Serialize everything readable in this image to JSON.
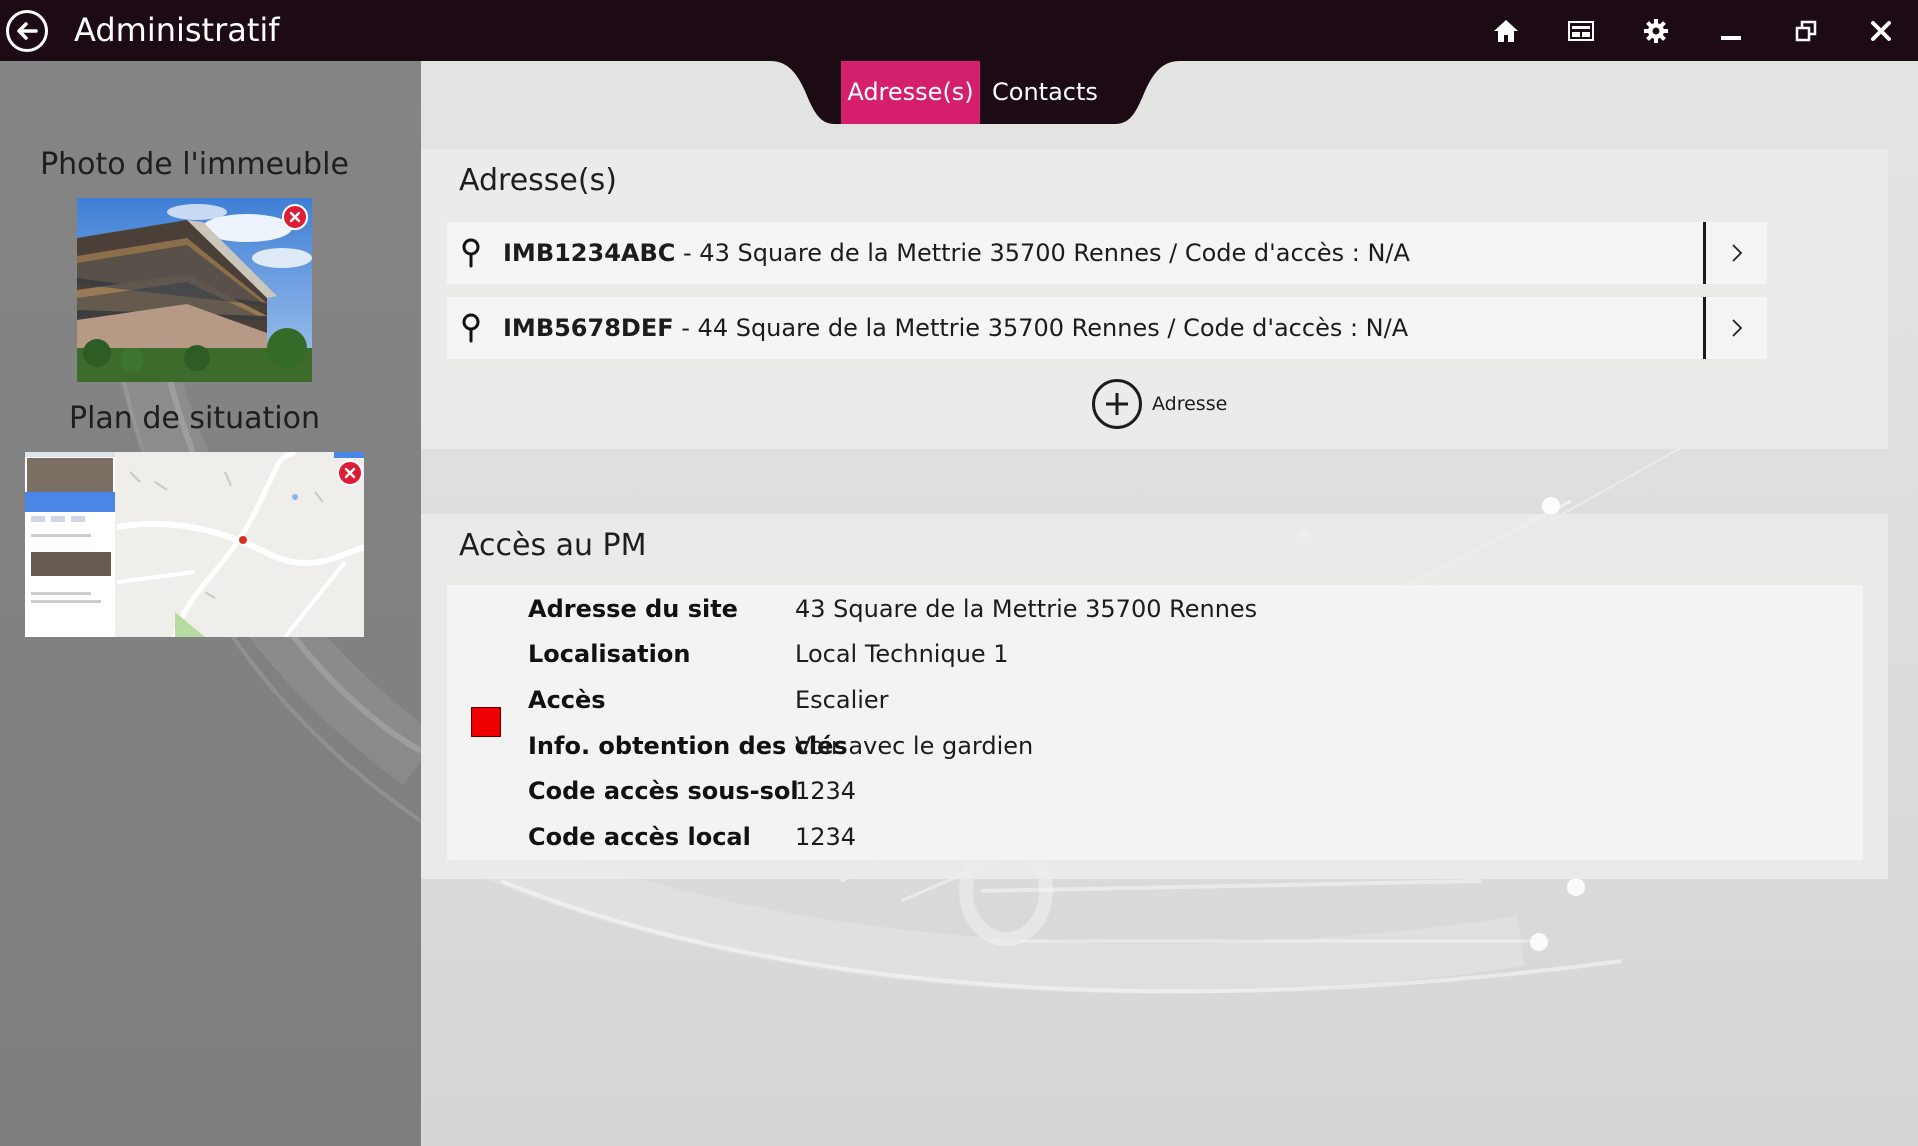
{
  "titlebar": {
    "title": "Administratif",
    "icons": [
      "back-arrow-icon",
      "home-icon",
      "dashboard-icon",
      "gear-icon",
      "minimize-icon",
      "restore-icon",
      "close-icon"
    ]
  },
  "sidebar": {
    "photo_heading": "Photo de l'immeuble",
    "plan_heading": "Plan de situation"
  },
  "tabs": [
    {
      "label": "Adresse(s)",
      "active": true
    },
    {
      "label": "Contacts",
      "active": false
    }
  ],
  "addresses_panel": {
    "title": "Adresse(s)",
    "rows": [
      {
        "code": "IMB1234ABC",
        "address": " - 43 Square de la Mettrie 35700 Rennes",
        "access": " / Code d'accès : N/A"
      },
      {
        "code": "IMB5678DEF",
        "address": " - 44 Square de la Mettrie 35700 Rennes",
        "access": " / Code d'accès : N/A"
      }
    ],
    "add_label": "Adresse"
  },
  "pm_panel": {
    "title": "Accès au PM",
    "status_color": "#ee0000",
    "rows": [
      {
        "label": "Adresse du site",
        "value": "43 Square de la Mettrie 35700 Rennes"
      },
      {
        "label": "Localisation",
        "value": "Local Technique 1"
      },
      {
        "label": "Accès",
        "value": "Escalier"
      },
      {
        "label": "Info. obtention des clés",
        "value": "Voir avec le gardien"
      },
      {
        "label": "Code accès sous-sol",
        "value": "1234"
      },
      {
        "label": "Code accès local",
        "value": "1234"
      }
    ]
  },
  "colors": {
    "titlebar": "#1c0b14",
    "accent": "#d4206c",
    "remove": "#e01b34"
  }
}
